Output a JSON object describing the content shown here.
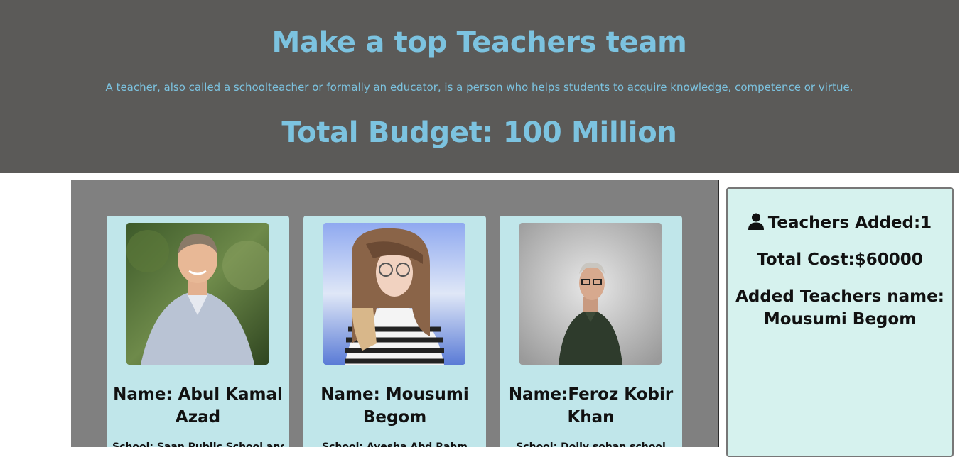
{
  "header": {
    "title": "Make a top Teachers team",
    "description": "A teacher, also called a schoolteacher or formally an educator, is a person who helps students to acquire knowledge, competence or virtue.",
    "budget": "Total Budget: 100 Million"
  },
  "teachers": [
    {
      "name": "Name: Abul Kamal Azad",
      "school": "School: Saan Public School and"
    },
    {
      "name": "Name: Mousumi Begom",
      "school": "School: Ayesha Abd Rahm"
    },
    {
      "name": "Name:Feroz Kobir Khan",
      "school": "School: Dolly sohan school"
    }
  ],
  "summary": {
    "icon": "user-icon",
    "teachers_added": "Teachers Added:1",
    "total_cost": "Total Cost:$60000",
    "added_label": "Added Teachers name:",
    "added_names": "Mousumi Begom"
  },
  "colors": {
    "header_bg": "#5b5a58",
    "accent_text": "#7cc3e0",
    "panel_bg": "#808080",
    "card_bg": "#c0e6ea",
    "summary_bg": "#d6f2ee"
  }
}
